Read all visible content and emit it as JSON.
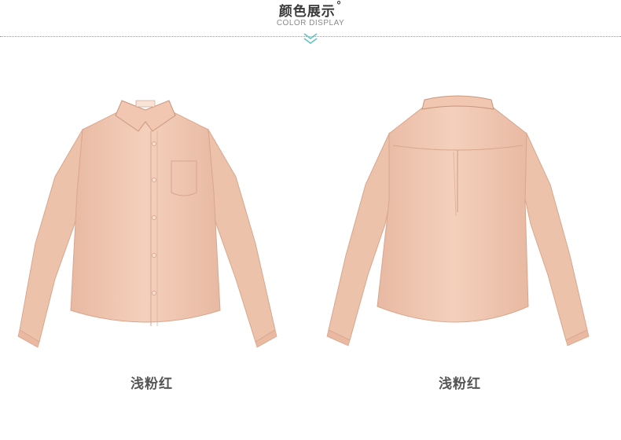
{
  "header": {
    "title": "颜色展示",
    "title_mark": "°",
    "subtitle": "COLOR DISPLAY",
    "chevron_icon": "double-chevron-down-icon",
    "accent_color": "#5fc4c8"
  },
  "products": [
    {
      "view": "front",
      "image_icon": "shirt-front-image",
      "color_label": "浅粉红",
      "shirt_color": "#f2cbb6"
    },
    {
      "view": "back",
      "image_icon": "shirt-back-image",
      "color_label": "浅粉红",
      "shirt_color": "#f2cbb6"
    }
  ]
}
